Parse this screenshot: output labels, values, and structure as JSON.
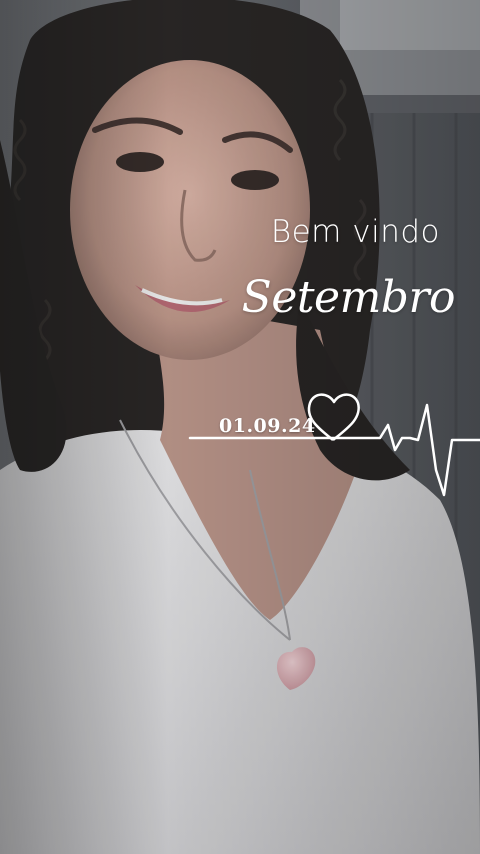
{
  "overlay": {
    "greeting": "Bem vindo",
    "month": "Setembro",
    "date": "01.09.24"
  },
  "icons": {
    "heart": "heart-outline-icon",
    "heartbeat": "heartbeat-line"
  },
  "colors": {
    "text": "#ffffff",
    "wall": "#55595f",
    "shirt": "#d9d9db",
    "hair": "#1a1716",
    "skin": "#c99e8f",
    "pendant": "#e3b6bd"
  }
}
